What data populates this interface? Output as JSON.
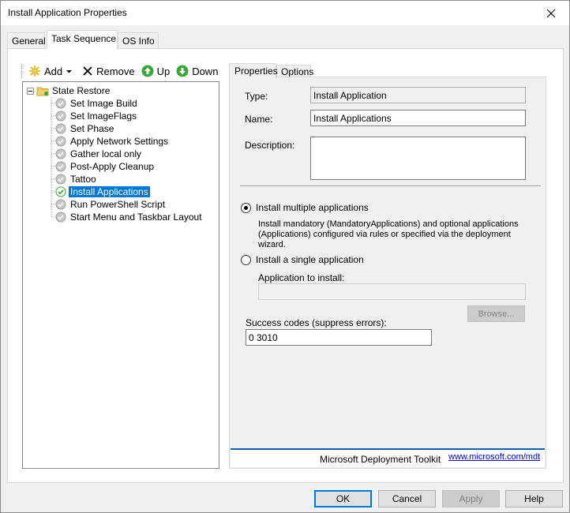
{
  "window": {
    "title": "Install Application Properties"
  },
  "outer_tabs": [
    "General",
    "Task Sequence",
    "OS Info"
  ],
  "toolbar": {
    "add": "Add",
    "remove": "Remove",
    "up": "Up",
    "down": "Down"
  },
  "tree": {
    "root": "State Restore",
    "items": [
      {
        "label": "Set Image Build",
        "selected": false
      },
      {
        "label": "Set ImageFlags",
        "selected": false
      },
      {
        "label": "Set Phase",
        "selected": false
      },
      {
        "label": "Apply Network Settings",
        "selected": false
      },
      {
        "label": "Gather local only",
        "selected": false
      },
      {
        "label": "Post-Apply Cleanup",
        "selected": false
      },
      {
        "label": "Tattoo",
        "selected": false
      },
      {
        "label": "Install Applications",
        "selected": true
      },
      {
        "label": "Run PowerShell Script",
        "selected": false
      },
      {
        "label": "Start Menu and Taskbar Layout",
        "selected": false
      }
    ]
  },
  "inner_tabs": [
    "Properties",
    "Options"
  ],
  "form": {
    "type_label": "Type:",
    "type_value": "Install Application",
    "name_label": "Name:",
    "name_value": "Install Applications",
    "description_label": "Description:",
    "description_value": "",
    "radio_multiple": "Install multiple applications",
    "multiple_desc": [
      "Install mandatory (MandatoryApplications) and optional applications",
      "(Applications) configured via rules or specified via the deployment",
      "wizard."
    ],
    "radio_single": "Install a single application",
    "app_to_install_label": "Application to install:",
    "app_to_install_value": "",
    "browse": "Browse...",
    "success_codes_label": "Success codes (suppress errors):",
    "success_codes_value": "0 3010"
  },
  "footer": {
    "brand": "Microsoft Deployment Toolkit",
    "link": "www.microsoft.com/mdt"
  },
  "buttons": {
    "ok": "OK",
    "cancel": "Cancel",
    "apply": "Apply",
    "help": "Help"
  },
  "colors": {
    "selection": "#0078d7",
    "link": "#0000ee",
    "brand_line": "#0063b1"
  }
}
